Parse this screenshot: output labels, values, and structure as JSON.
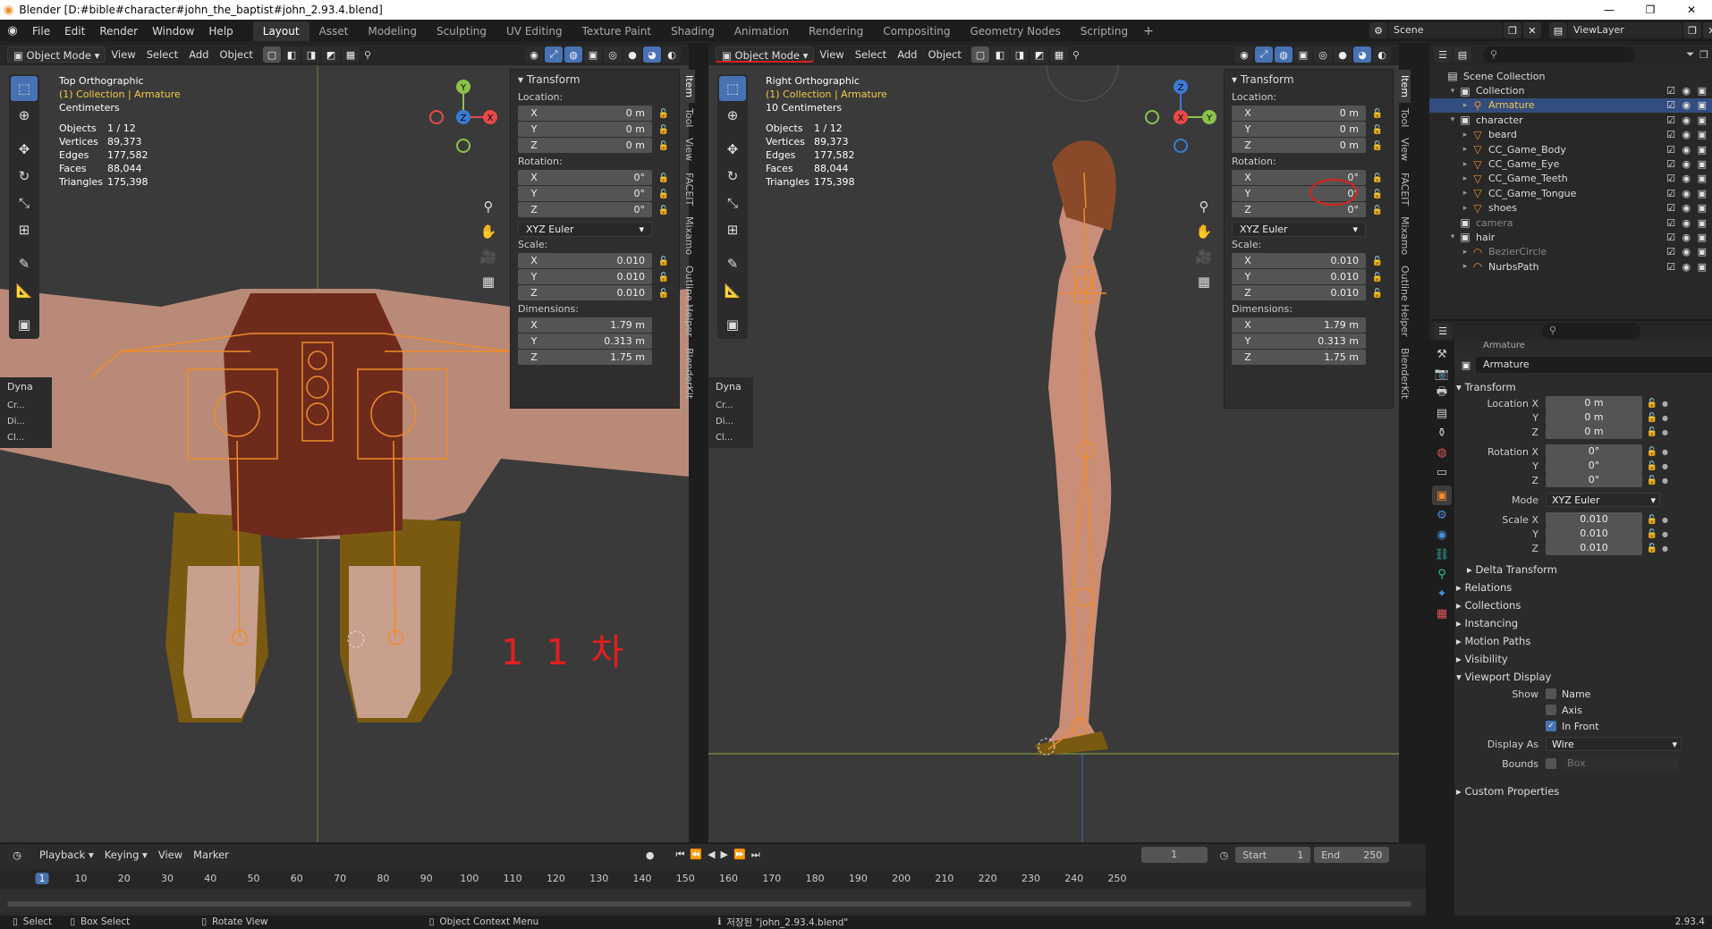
{
  "titlebar": {
    "title": "Blender [D:#bible#character#john_the_baptist#john_2.93.4.blend]",
    "minimize": "—",
    "maximize": "❐",
    "close": "✕"
  },
  "menus": [
    "File",
    "Edit",
    "Render",
    "Window",
    "Help"
  ],
  "workspaces": [
    "Layout",
    "Asset",
    "Modeling",
    "Sculpting",
    "UV Editing",
    "Texture Paint",
    "Shading",
    "Animation",
    "Rendering",
    "Compositing",
    "Geometry Nodes",
    "Scripting"
  ],
  "add_workspace": "+",
  "scene": {
    "name": "Scene",
    "view_layer": "ViewLayer"
  },
  "left_viewport": {
    "mode": "Object Mode",
    "view": "View",
    "select": "Select",
    "add": "Add",
    "object": "Object",
    "view_name": "Top Orthographic",
    "collection": "(1) Collection | Armature",
    "units": "Centimeters",
    "stats": [
      [
        "Objects",
        "1 / 12"
      ],
      [
        "Vertices",
        "89,373"
      ],
      [
        "Edges",
        "177,582"
      ],
      [
        "Faces",
        "88,044"
      ],
      [
        "Triangles",
        "175,398"
      ]
    ],
    "dyna_label": "Dyna",
    "dyna_items": [
      "Cr...",
      "Di...",
      "Cl..."
    ],
    "annotation": "1 1 차"
  },
  "right_viewport": {
    "mode": "Object Mode",
    "view": "View",
    "select": "Select",
    "add": "Add",
    "object": "Object",
    "view_name": "Right Orthographic",
    "collection": "(1) Collection | Armature",
    "units": "10 Centimeters",
    "stats": [
      [
        "Objects",
        "1 / 12"
      ],
      [
        "Vertices",
        "89,373"
      ],
      [
        "Edges",
        "177,582"
      ],
      [
        "Faces",
        "88,044"
      ],
      [
        "Triangles",
        "175,398"
      ]
    ],
    "dyna_label": "Dyna",
    "dyna_items": [
      "Cr...",
      "Di...",
      "Cl..."
    ]
  },
  "transform_panel": {
    "title": "Transform",
    "location_label": "Location:",
    "location": [
      [
        "X",
        "0 m"
      ],
      [
        "Y",
        "0 m"
      ],
      [
        "Z",
        "0 m"
      ]
    ],
    "rotation_label": "Rotation:",
    "rotation": [
      [
        "X",
        "0°"
      ],
      [
        "Y",
        "0°"
      ],
      [
        "Z",
        "0°"
      ]
    ],
    "rotation_mode": "XYZ Euler",
    "scale_label": "Scale:",
    "scale": [
      [
        "X",
        "0.010"
      ],
      [
        "Y",
        "0.010"
      ],
      [
        "Z",
        "0.010"
      ]
    ],
    "dimensions_label": "Dimensions:",
    "dimensions": [
      [
        "X",
        "1.79 m"
      ],
      [
        "Y",
        "0.313 m"
      ],
      [
        "Z",
        "1.75 m"
      ]
    ]
  },
  "ntabs": [
    "Item",
    "Tool",
    "View",
    "FACEIT",
    "Mixamo",
    "Outline Helper",
    "BlenderKit"
  ],
  "outliner": {
    "rows": [
      {
        "indent": 0,
        "label": "Scene Collection",
        "icon": "▤",
        "tri": ""
      },
      {
        "indent": 1,
        "label": "Collection",
        "icon": "▣",
        "tri": "▾"
      },
      {
        "indent": 2,
        "label": "Armature",
        "icon": "⚲",
        "tri": "▸",
        "sel": true
      },
      {
        "indent": 1,
        "label": "character",
        "icon": "▣",
        "tri": "▾"
      },
      {
        "indent": 2,
        "label": "beard",
        "icon": "▽",
        "tri": "▸"
      },
      {
        "indent": 2,
        "label": "CC_Game_Body",
        "icon": "▽",
        "tri": "▸"
      },
      {
        "indent": 2,
        "label": "CC_Game_Eye",
        "icon": "▽",
        "tri": "▸"
      },
      {
        "indent": 2,
        "label": "CC_Game_Teeth",
        "icon": "▽",
        "tri": "▸"
      },
      {
        "indent": 2,
        "label": "CC_Game_Tongue",
        "icon": "▽",
        "tri": "▸"
      },
      {
        "indent": 2,
        "label": "shoes",
        "icon": "▽",
        "tri": "▸"
      },
      {
        "indent": 1,
        "label": "camera",
        "icon": "▣",
        "tri": "",
        "dim": true
      },
      {
        "indent": 1,
        "label": "hair",
        "icon": "▣",
        "tri": "▾"
      },
      {
        "indent": 2,
        "label": "BezierCircle",
        "icon": "◠",
        "tri": "▸",
        "dim": true
      },
      {
        "indent": 2,
        "label": "NurbsPath",
        "icon": "◠",
        "tri": "▸"
      }
    ]
  },
  "properties": {
    "breadcrumb": "Armature",
    "object_name": "Armature",
    "transform": "Transform",
    "location": [
      [
        "Location X",
        "0 m"
      ],
      [
        "Y",
        "0 m"
      ],
      [
        "Z",
        "0 m"
      ]
    ],
    "rotation": [
      [
        "Rotation X",
        "0°"
      ],
      [
        "Y",
        "0°"
      ],
      [
        "Z",
        "0°"
      ]
    ],
    "mode_label": "Mode",
    "mode_value": "XYZ Euler",
    "scale": [
      [
        "Scale X",
        "0.010"
      ],
      [
        "Y",
        "0.010"
      ],
      [
        "Z",
        "0.010"
      ]
    ],
    "delta": "Delta Transform",
    "sections": [
      "Relations",
      "Collections",
      "Instancing",
      "Motion Paths",
      "Visibility"
    ],
    "viewport_display": "Viewport Display",
    "show_label": "Show",
    "name_opt": "Name",
    "axis_opt": "Axis",
    "infront_opt": "In Front",
    "display_as_label": "Display As",
    "display_as": "Wire",
    "bounds_label": "Bounds",
    "bounds": "Box",
    "custom": "Custom Properties"
  },
  "timeline": {
    "playback": "Playback",
    "keying": "Keying",
    "view": "View",
    "marker": "Marker",
    "current": "1",
    "start_label": "Start",
    "start": "1",
    "end_label": "End",
    "end": "250",
    "ticks": [
      "1",
      "10",
      "20",
      "30",
      "40",
      "50",
      "60",
      "70",
      "80",
      "90",
      "100",
      "110",
      "120",
      "130",
      "140",
      "150",
      "160",
      "170",
      "180",
      "190",
      "200",
      "210",
      "220",
      "230",
      "240",
      "250"
    ]
  },
  "statusbar": {
    "select": "Select",
    "box_select": "Box Select",
    "rotate": "Rotate View",
    "context": "Object Context Menu",
    "saved": "저장된 \"john_2.93.4.blend\"",
    "version": "2.93.4"
  },
  "colors": {
    "accent": "#4772b3",
    "orange": "#f08c2a",
    "annotation": "#e0201e",
    "skin": "#c98d78",
    "bg": "#3a3a3a"
  }
}
